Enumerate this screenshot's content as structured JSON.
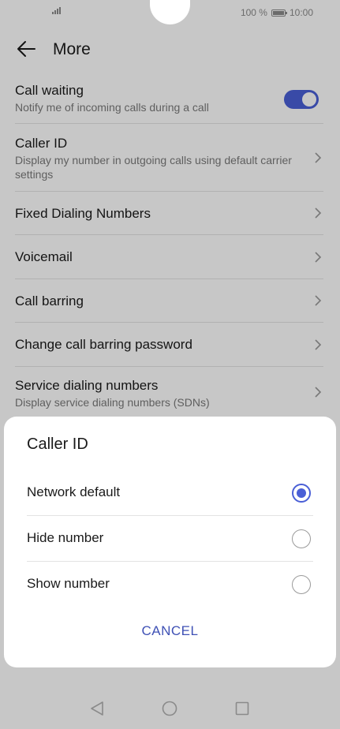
{
  "status_bar": {
    "battery_percent": "100 %",
    "time": "10:00"
  },
  "header": {
    "title": "More",
    "back_icon": "back-arrow-icon"
  },
  "settings": [
    {
      "title": "Call waiting",
      "subtitle": "Notify me of incoming calls during a call",
      "control": "toggle",
      "toggle_on": true
    },
    {
      "title": "Caller ID",
      "subtitle": "Display my number in outgoing calls using default carrier settings",
      "control": "chevron"
    },
    {
      "title": "Fixed Dialing Numbers",
      "subtitle": "",
      "control": "chevron"
    },
    {
      "title": "Voicemail",
      "subtitle": "",
      "control": "chevron"
    },
    {
      "title": "Call barring",
      "subtitle": "",
      "control": "chevron"
    },
    {
      "title": "Change call barring password",
      "subtitle": "",
      "control": "chevron"
    },
    {
      "title": "Service dialing numbers",
      "subtitle": "Display service dialing numbers (SDNs)",
      "control": "chevron"
    }
  ],
  "dialog": {
    "title": "Caller ID",
    "options": [
      {
        "label": "Network default",
        "selected": true
      },
      {
        "label": "Hide number",
        "selected": false
      },
      {
        "label": "Show number",
        "selected": false
      }
    ],
    "cancel_label": "CANCEL"
  },
  "nav_bar": {
    "icons": [
      "back-triangle-icon",
      "home-circle-icon",
      "recents-square-icon"
    ]
  },
  "colors": {
    "accent": "#4A5FD6",
    "cancel_text": "#3F51B5"
  }
}
